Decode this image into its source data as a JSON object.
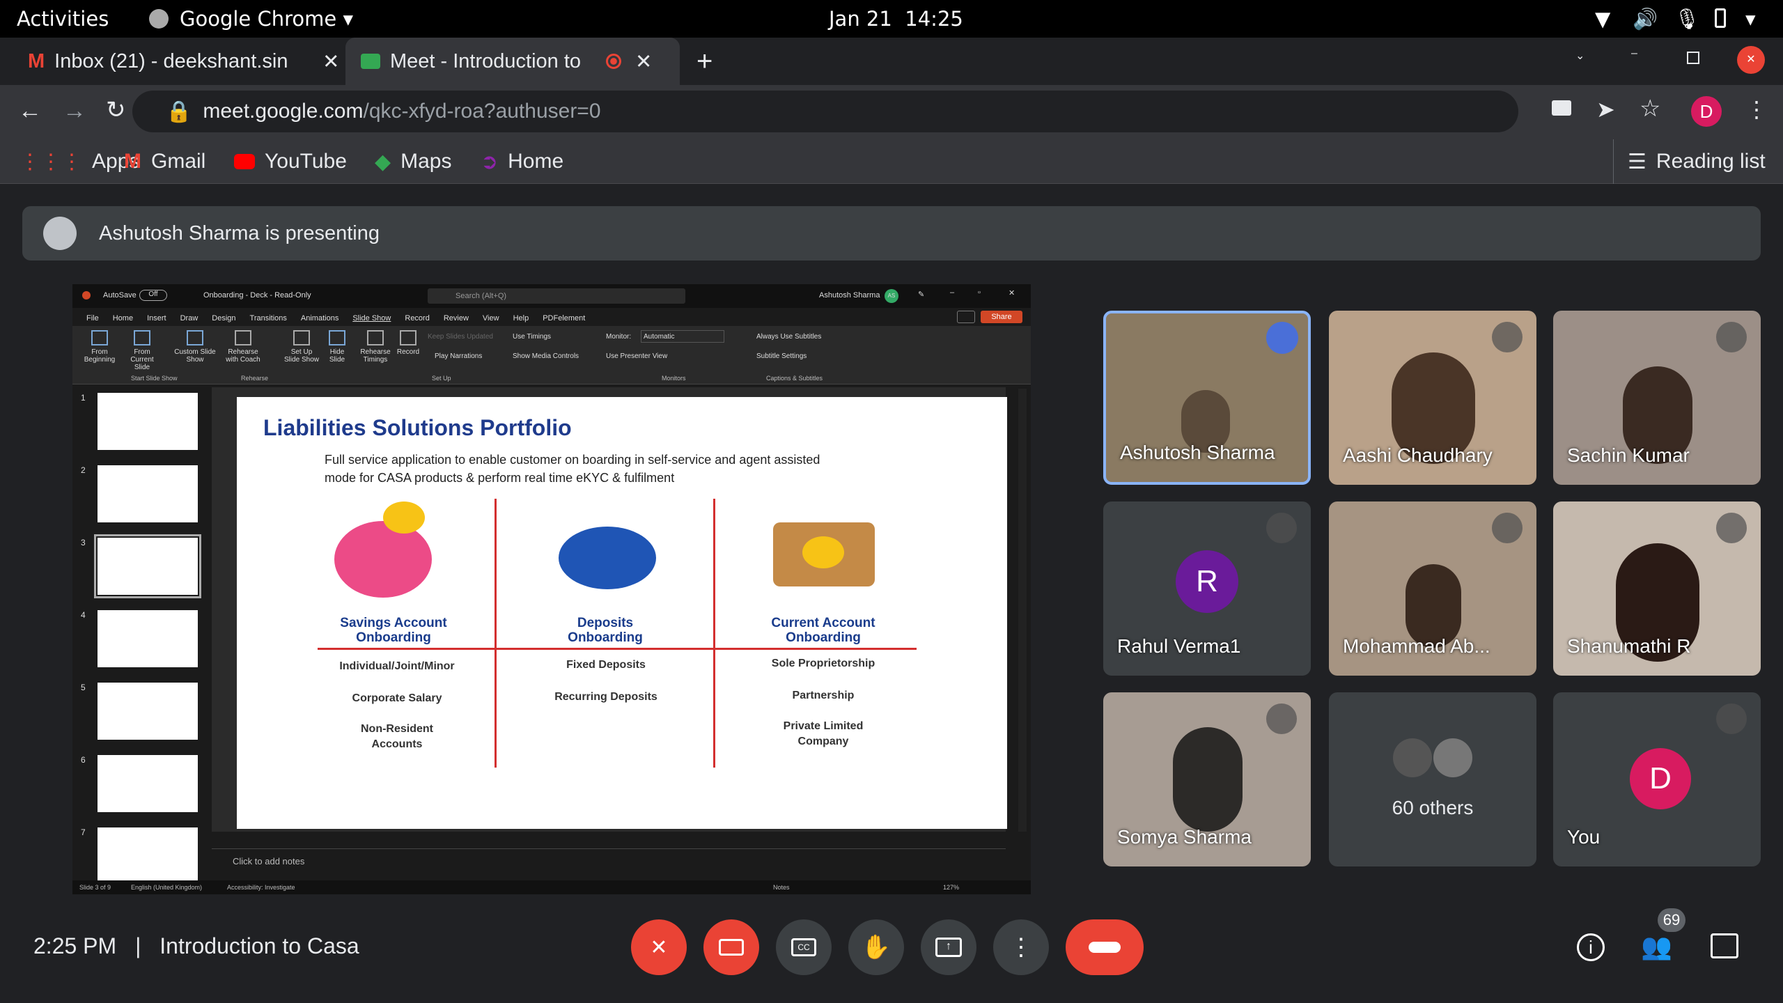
{
  "system": {
    "activities": "Activities",
    "app": "Google Chrome",
    "date": "Jan 21",
    "time": "14:25"
  },
  "tabs": [
    {
      "label": "Inbox (21) - deekshant.sin"
    },
    {
      "label": "Meet - Introduction to"
    }
  ],
  "address": {
    "host": "meet.google.com",
    "path": "/qkc-xfyd-roa?authuser=0"
  },
  "profile": {
    "initial": "D"
  },
  "bookmarks": {
    "apps": "Apps",
    "gmail": "Gmail",
    "youtube": "YouTube",
    "maps": "Maps",
    "home": "Home",
    "reading": "Reading list"
  },
  "banner": {
    "text": "Ashutosh Sharma is presenting"
  },
  "ppt": {
    "autosave": "AutoSave",
    "autosave_state": "Off",
    "doc": "Onboarding - Deck - Read-Only",
    "search": "Search (Alt+Q)",
    "user": "Ashutosh Sharma",
    "user_init": "AS",
    "share": "Share",
    "menu": [
      "File",
      "Home",
      "Insert",
      "Draw",
      "Design",
      "Transitions",
      "Animations",
      "Slide Show",
      "Record",
      "Review",
      "View",
      "Help",
      "PDFelement"
    ],
    "ribbon": {
      "from_beginning": "From Beginning",
      "from_current": "From Current Slide",
      "custom": "Custom Slide Show",
      "rehearse_coach": "Rehearse with Coach",
      "setup_show": "Set Up Slide Show",
      "hide": "Hide Slide",
      "rehearse_timings": "Rehearse Timings",
      "record": "Record",
      "keep": "Keep Slides Updated",
      "play_narr": "Play Narrations",
      "use_timings": "Use Timings",
      "show_media": "Show Media Controls",
      "monitor": "Monitor:",
      "monitor_val": "Automatic",
      "presenter": "Use Presenter View",
      "subtitles": "Always Use Subtitles",
      "sub_settings": "Subtitle Settings",
      "g1": "Start Slide Show",
      "g2": "Rehearse",
      "g3": "Set Up",
      "g4": "Monitors",
      "g5": "Captions & Subtitles"
    },
    "thumbs": [
      "1",
      "2",
      "3",
      "4",
      "5",
      "6",
      "7"
    ],
    "notes": "Click to add notes",
    "status": {
      "slide": "Slide 3 of 9",
      "lang": "English (United Kingdom)",
      "access": "Accessibility: Investigate",
      "notes_btn": "Notes",
      "zoom": "127%"
    }
  },
  "slide": {
    "title": "Liabilities Solutions Portfolio",
    "sub1": "Full service application to enable customer on boarding in self-service and agent assisted",
    "sub2": "mode for CASA products & perform real time eKYC & fulfilment",
    "cols": [
      {
        "t1": "Savings Account",
        "t2": "Onboarding",
        "items": [
          "Individual/Joint/Minor",
          "Corporate Salary",
          "Non-Resident",
          "Accounts"
        ]
      },
      {
        "t1": "Deposits",
        "t2": "Onboarding",
        "items": [
          "Fixed Deposits",
          "Recurring Deposits"
        ]
      },
      {
        "t1": "Current Account",
        "t2": "Onboarding",
        "items": [
          "Sole Proprietorship",
          "Partnership",
          "Private Limited",
          "Company"
        ]
      }
    ]
  },
  "participants": [
    {
      "name": "Ashutosh Sharma"
    },
    {
      "name": "Aashi Chaudhary"
    },
    {
      "name": "Sachin Kumar"
    },
    {
      "name": "Rahul Verma1",
      "initial": "R"
    },
    {
      "name": "Mohammad Ab..."
    },
    {
      "name": "Shanumathi R"
    },
    {
      "name": "Somya Sharma"
    },
    {
      "name": "60 others"
    },
    {
      "name": "You",
      "initial": "D"
    }
  ],
  "bottom": {
    "time": "2:25 PM",
    "separator": "|",
    "meeting": "Introduction to Casa",
    "people_count": "69"
  },
  "colors": {
    "accent_blue": "#8ab4f8",
    "red": "#ea4335",
    "slide_title": "#1f3b8c",
    "divider": "#d32f2f"
  }
}
